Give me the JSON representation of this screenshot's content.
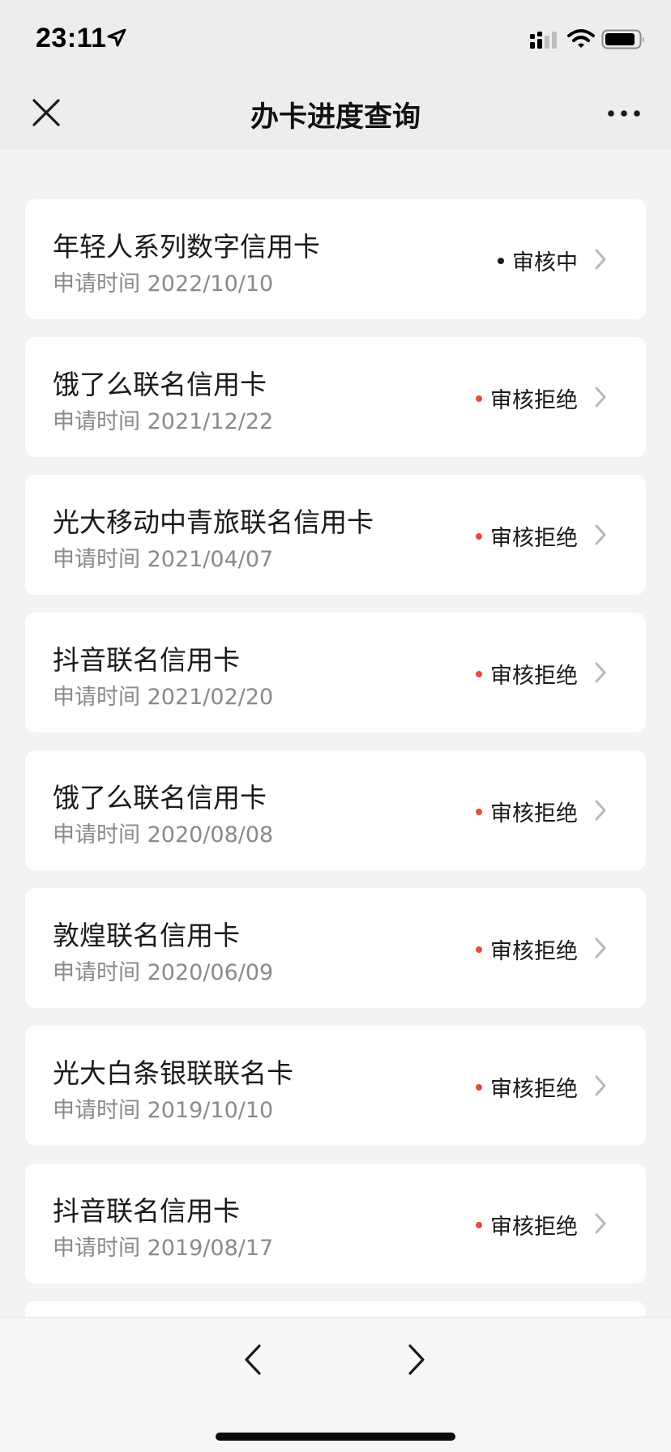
{
  "status_bar": {
    "time": "23:11"
  },
  "nav": {
    "title": "办卡进度查询"
  },
  "colors": {
    "pending_dot": "#1a1a1a",
    "rejected_dot": "#e94a3c"
  },
  "applications": [
    {
      "name": "年轻人系列数字信用卡",
      "date": "申请时间 2022/10/10",
      "status": "审核中",
      "state": "pending"
    },
    {
      "name": "饿了么联名信用卡",
      "date": "申请时间 2021/12/22",
      "status": "审核拒绝",
      "state": "rejected"
    },
    {
      "name": "光大移动中青旅联名信用卡",
      "date": "申请时间 2021/04/07",
      "status": "审核拒绝",
      "state": "rejected"
    },
    {
      "name": "抖音联名信用卡",
      "date": "申请时间 2021/02/20",
      "status": "审核拒绝",
      "state": "rejected"
    },
    {
      "name": "饿了么联名信用卡",
      "date": "申请时间 2020/08/08",
      "status": "审核拒绝",
      "state": "rejected"
    },
    {
      "name": "敦煌联名信用卡",
      "date": "申请时间 2020/06/09",
      "status": "审核拒绝",
      "state": "rejected"
    },
    {
      "name": "光大白条银联联名卡",
      "date": "申请时间 2019/10/10",
      "status": "审核拒绝",
      "state": "rejected"
    },
    {
      "name": "抖音联名信用卡",
      "date": "申请时间 2019/08/17",
      "status": "审核拒绝",
      "state": "rejected"
    }
  ],
  "icons": {
    "close": "close-icon",
    "more": "more-dots-icon",
    "back": "chevron-left-icon",
    "forward": "chevron-right-icon",
    "row_arrow": "chevron-right-icon"
  }
}
